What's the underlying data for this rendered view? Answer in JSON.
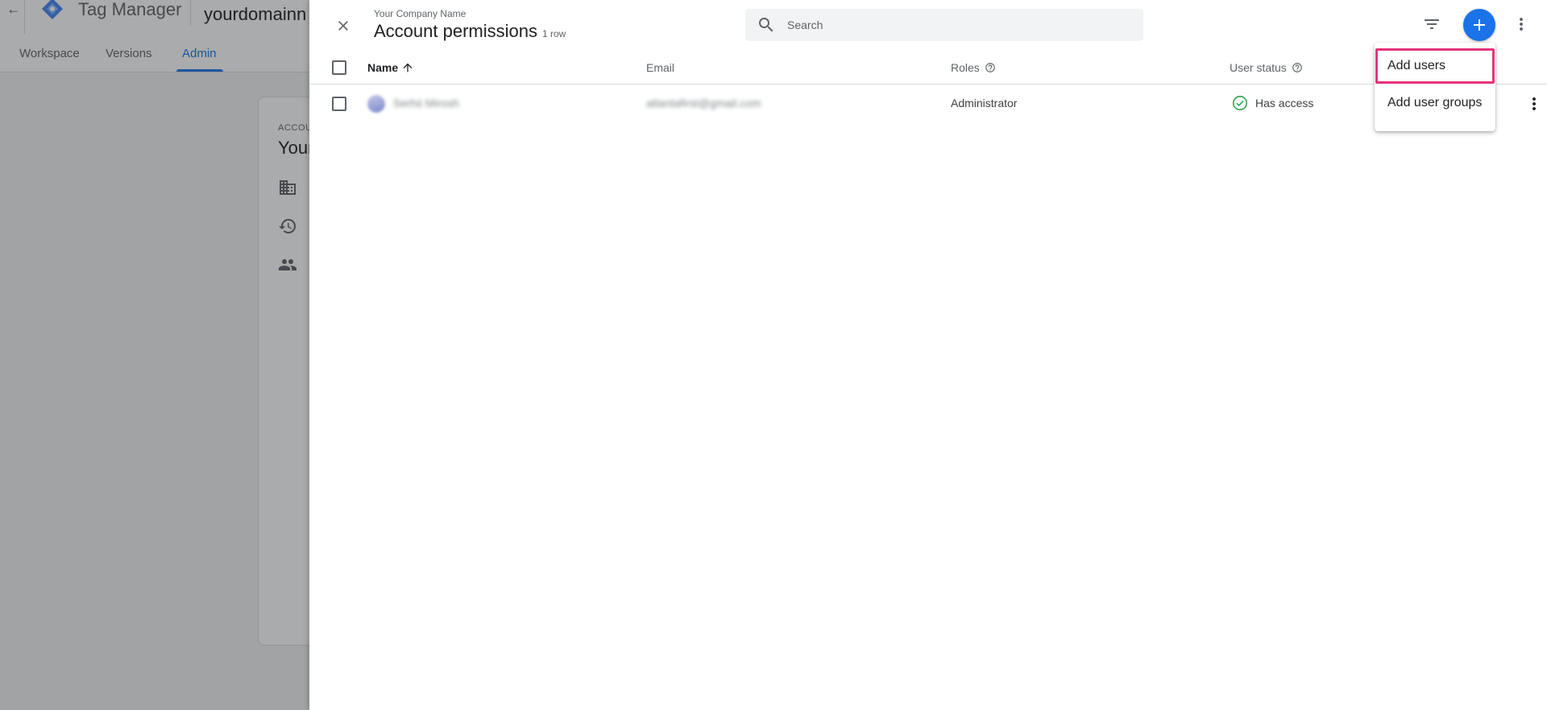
{
  "background": {
    "app_name": "Tag Manager",
    "container_name": "yourdomainn",
    "tabs": [
      {
        "label": "Workspace"
      },
      {
        "label": "Versions"
      },
      {
        "label": "Admin"
      }
    ],
    "card": {
      "eyebrow": "ACCOU",
      "title": "Your"
    }
  },
  "panel": {
    "subtitle": "Your Company Name",
    "title": "Account permissions",
    "row_count": "1 row",
    "search": {
      "placeholder": "Search",
      "value": ""
    },
    "columns": {
      "name": "Name",
      "email": "Email",
      "roles": "Roles",
      "user_status": "User status"
    },
    "rows": [
      {
        "name": "Serhii Mirosh",
        "email": "atlantafirst@gmail.com",
        "role": "Administrator",
        "status": "Has access"
      }
    ]
  },
  "menu": {
    "items": [
      {
        "label": "Add users"
      },
      {
        "label": "Add user groups"
      }
    ]
  },
  "colors": {
    "accent": "#1a73e8",
    "highlight": "#e8317a",
    "status_ok": "#34a853"
  }
}
